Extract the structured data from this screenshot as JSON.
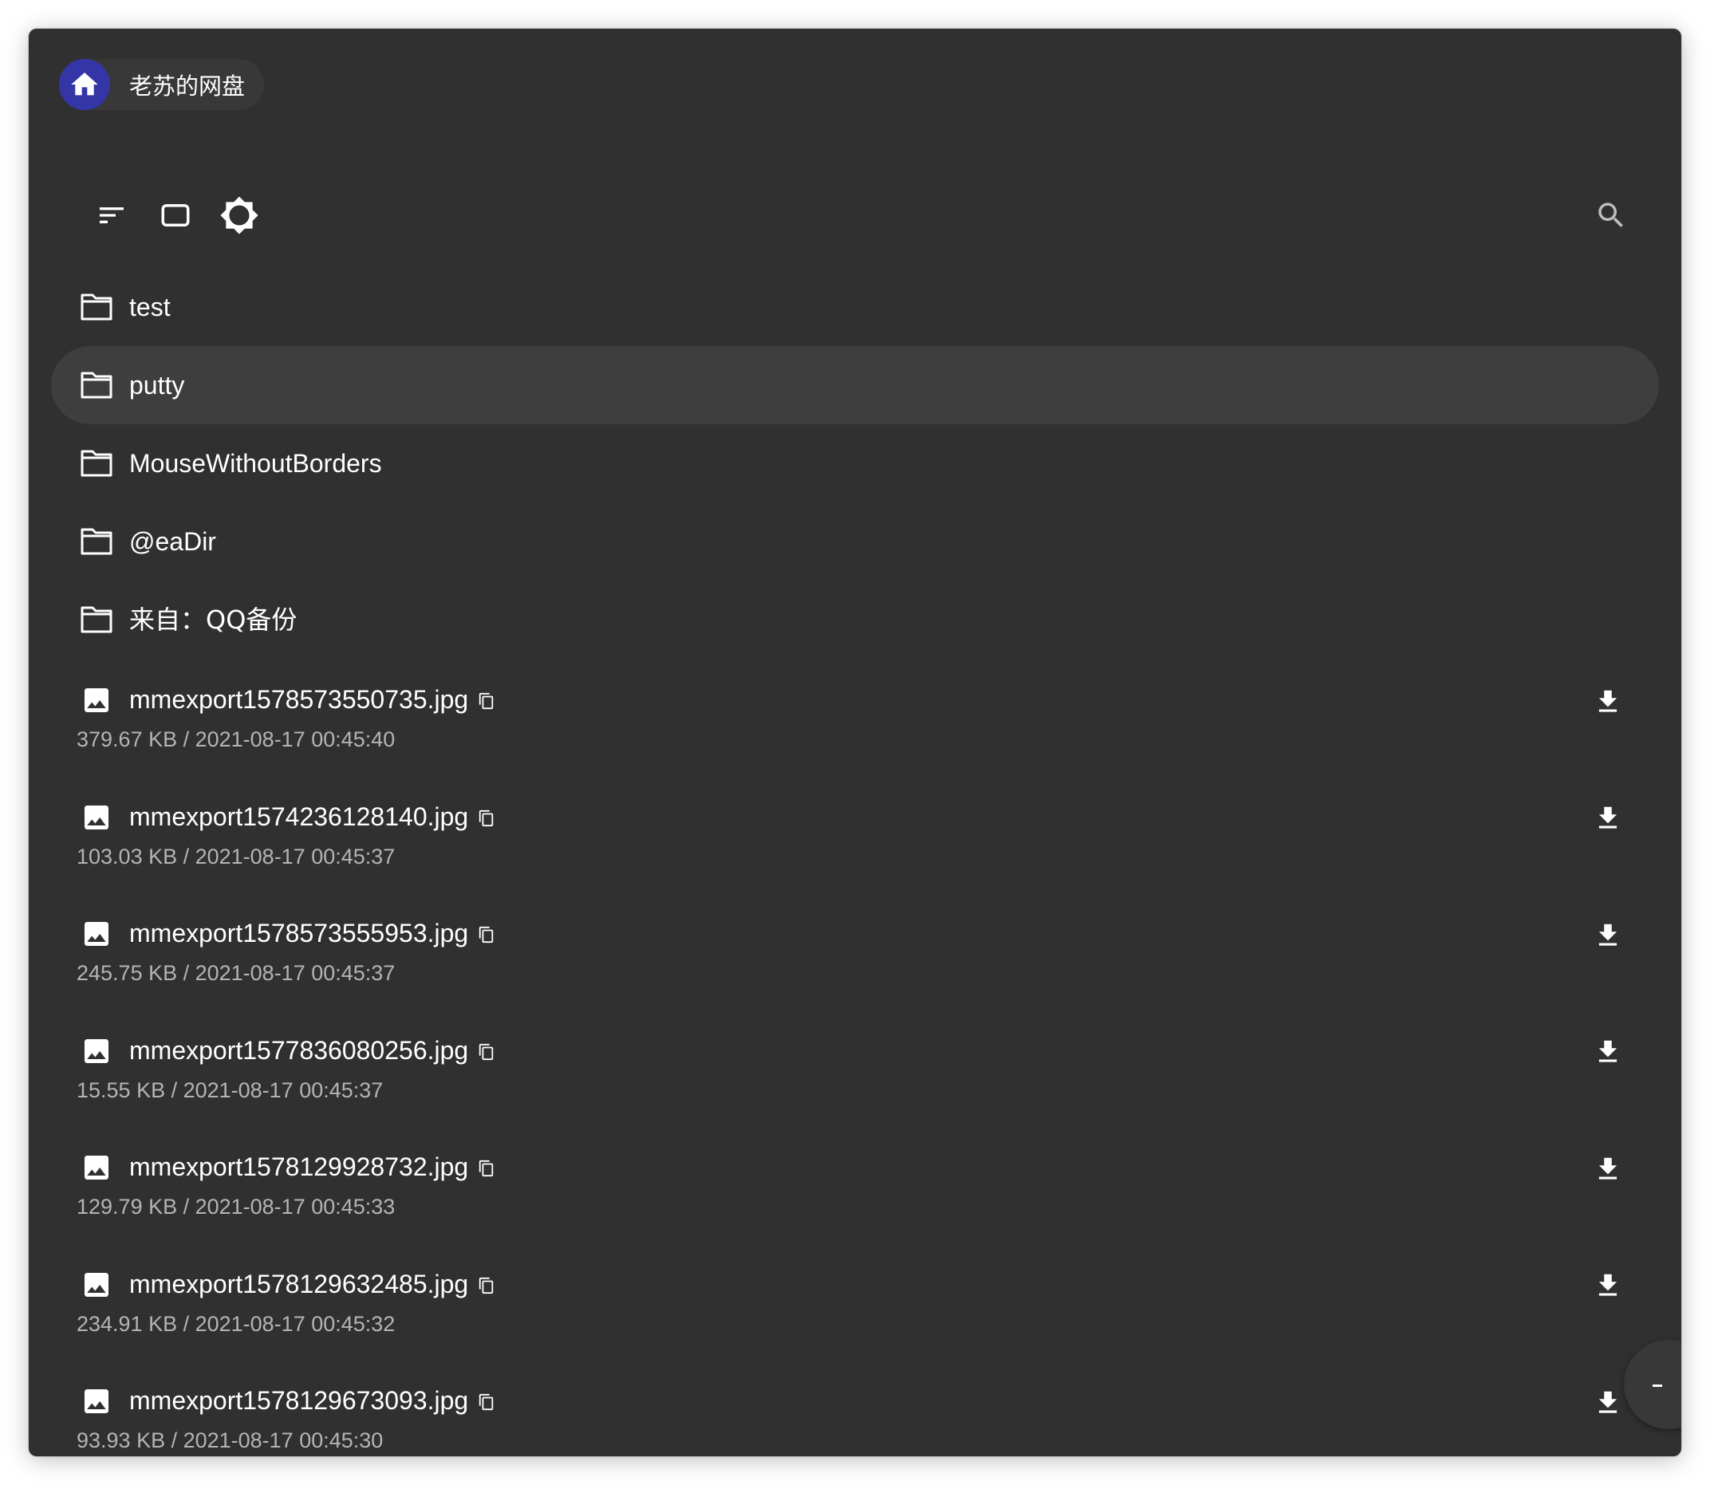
{
  "breadcrumb": {
    "home_icon": "home-icon",
    "label": "老苏的网盘"
  },
  "toolbar": {
    "sort_icon": "sort-icon",
    "view_icon": "view-mode-icon",
    "theme_icon": "brightness-icon",
    "search_icon": "search-icon"
  },
  "colors": {
    "background": "#303030",
    "active_row": "#3e3e3e",
    "home_accent": "#3436a8",
    "meta_text": "#b4b4b4"
  },
  "folders": [
    {
      "name": "test"
    },
    {
      "name": "putty"
    },
    {
      "name": "MouseWithoutBorders"
    },
    {
      "name": "@eaDir"
    },
    {
      "name": "来自：QQ备份"
    }
  ],
  "files": [
    {
      "name": "mmexport1578573550735.jpg",
      "meta": "379.67 KB / 2021-08-17 00:45:40"
    },
    {
      "name": "mmexport1574236128140.jpg",
      "meta": "103.03 KB / 2021-08-17 00:45:37"
    },
    {
      "name": "mmexport1578573555953.jpg",
      "meta": "245.75 KB / 2021-08-17 00:45:37"
    },
    {
      "name": "mmexport1577836080256.jpg",
      "meta": "15.55 KB / 2021-08-17 00:45:37"
    },
    {
      "name": "mmexport1578129928732.jpg",
      "meta": "129.79 KB / 2021-08-17 00:45:33"
    },
    {
      "name": "mmexport1578129632485.jpg",
      "meta": "234.91 KB / 2021-08-17 00:45:32"
    },
    {
      "name": "mmexport1578129673093.jpg",
      "meta": "93.93 KB / 2021-08-17 00:45:30"
    }
  ]
}
